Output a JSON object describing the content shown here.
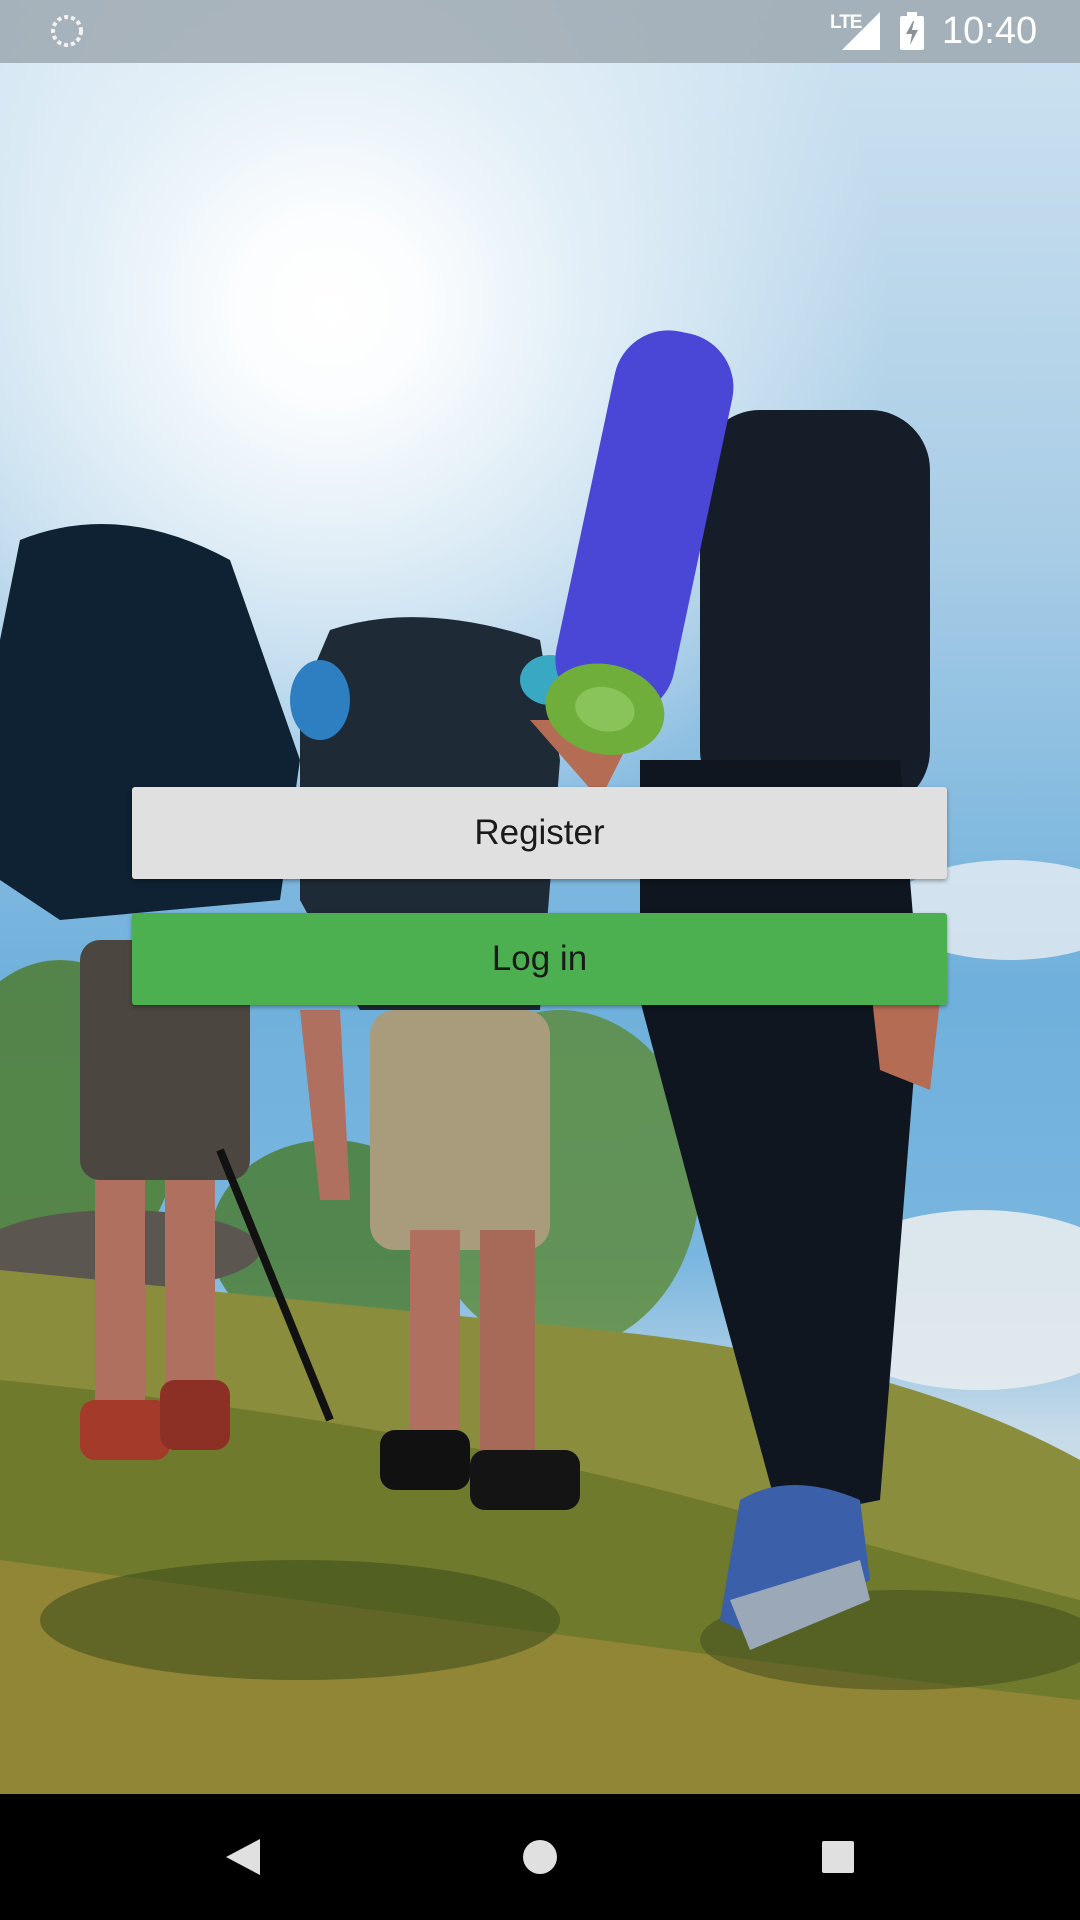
{
  "status_bar": {
    "network_label": "LTE",
    "time": "10:40"
  },
  "actions": {
    "register_label": "Register",
    "login_label": "Log in"
  },
  "background": {
    "description_icon": "hikers-photo"
  },
  "colors": {
    "register_button": "#e0e0e0",
    "login_button": "#4caf50",
    "nav_bar": "#000000"
  },
  "nav_bar": {
    "back_icon": "back-triangle-icon",
    "home_icon": "home-circle-icon",
    "recents_icon": "recents-square-icon"
  }
}
